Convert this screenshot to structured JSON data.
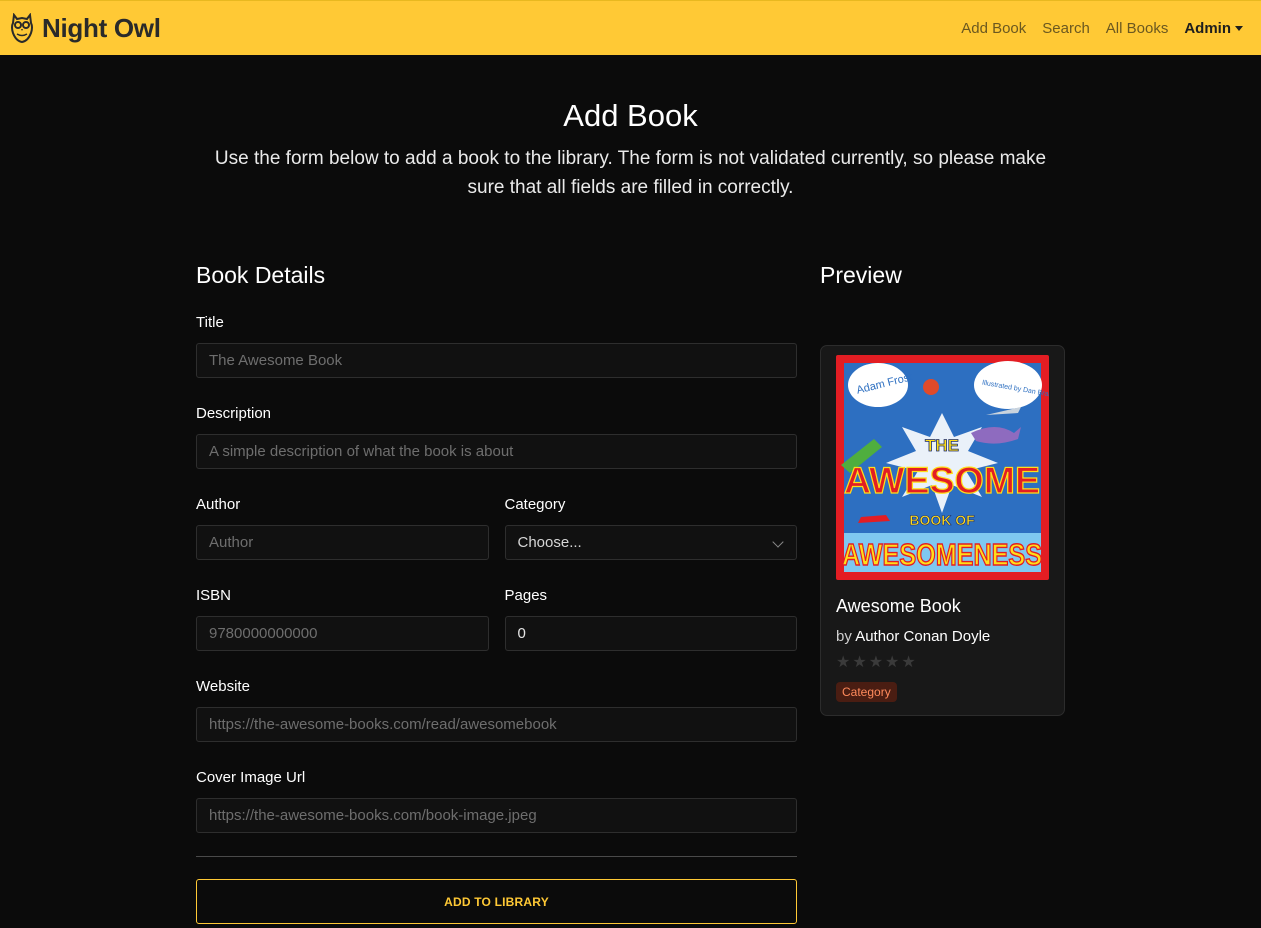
{
  "nav": {
    "brand": "Night Owl",
    "links": [
      "Add Book",
      "Search",
      "All Books"
    ],
    "admin": "Admin"
  },
  "header": {
    "title": "Add Book",
    "intro": "Use the form below to add a book to the library. The form is not validated currently, so please make sure that all fields are filled in correctly."
  },
  "form": {
    "section_title": "Book Details",
    "title": {
      "label": "Title",
      "placeholder": "The Awesome Book",
      "value": ""
    },
    "description": {
      "label": "Description",
      "placeholder": "A simple description of what the book is about",
      "value": ""
    },
    "author": {
      "label": "Author",
      "placeholder": "Author",
      "value": ""
    },
    "category": {
      "label": "Category",
      "selected": "Choose..."
    },
    "isbn": {
      "label": "ISBN",
      "placeholder": "9780000000000",
      "value": ""
    },
    "pages": {
      "label": "Pages",
      "value": "0"
    },
    "website": {
      "label": "Website",
      "placeholder": "https://the-awesome-books.com/read/awesomebook",
      "value": ""
    },
    "cover_url": {
      "label": "Cover Image Url",
      "placeholder": "https://the-awesome-books.com/book-image.jpeg",
      "value": ""
    },
    "submit_label": "ADD TO LIBRARY"
  },
  "preview": {
    "section_title": "Preview",
    "cover": {
      "author_bubble": "Adam Frost",
      "illustrator_bubble": "Illustrated by Dan Bramall",
      "line1": "THE",
      "line2": "AWESOME",
      "line3": "BOOK OF",
      "line4": "AWESOMENESS"
    },
    "book_title": "Awesome Book",
    "by": "by",
    "author": "Author Conan Doyle",
    "rating": 0,
    "max_rating": 5,
    "category": "Category"
  },
  "colors": {
    "brand_yellow": "#ffc935",
    "background": "#0b0b0b",
    "badge_bg": "#4a1d12",
    "badge_text": "#ff8a5c"
  }
}
